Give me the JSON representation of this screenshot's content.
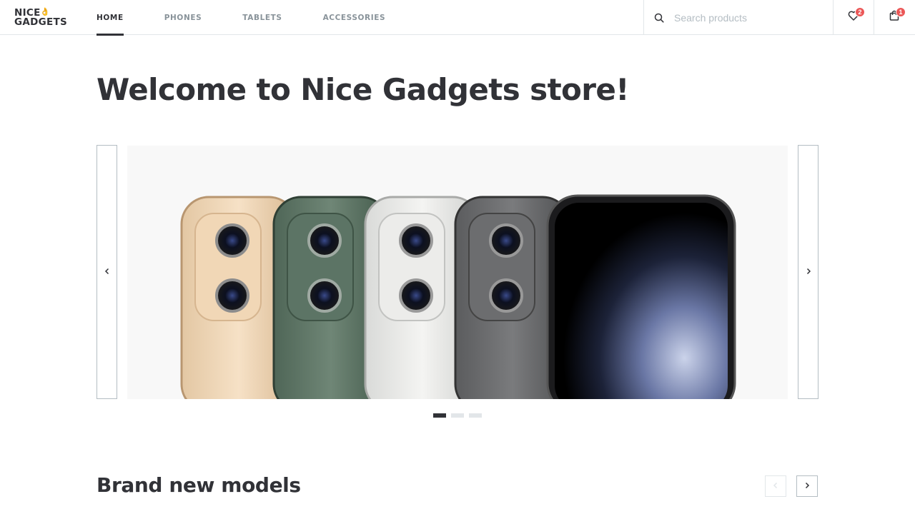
{
  "brand": {
    "line1": "NICE",
    "line2": "GADGETS",
    "emoji": "👌"
  },
  "nav": [
    {
      "label": "HOME",
      "active": true
    },
    {
      "label": "PHONES",
      "active": false
    },
    {
      "label": "TABLETS",
      "active": false
    },
    {
      "label": "ACCESSORIES",
      "active": false
    }
  ],
  "search": {
    "placeholder": "Search products",
    "value": ""
  },
  "favourites": {
    "icon": "heart-icon",
    "count": "2"
  },
  "cart": {
    "icon": "shopping-bag-icon",
    "count": "1"
  },
  "page": {
    "title": "Welcome to Nice Gadgets store!"
  },
  "slider": {
    "prev_icon": "chevron-left-icon",
    "next_icon": "chevron-right-icon",
    "slides_count": 3,
    "active_slide": 1,
    "banner_image": "iphone-11-pro-colors-banner"
  },
  "section": {
    "title": "Brand new models",
    "prev_disabled": true
  },
  "colors": {
    "primary": "#313237",
    "secondary": "#89939a",
    "border": "#e2e6e9",
    "badge": "#eb5757",
    "banner_bg": "#f8f8f8"
  }
}
